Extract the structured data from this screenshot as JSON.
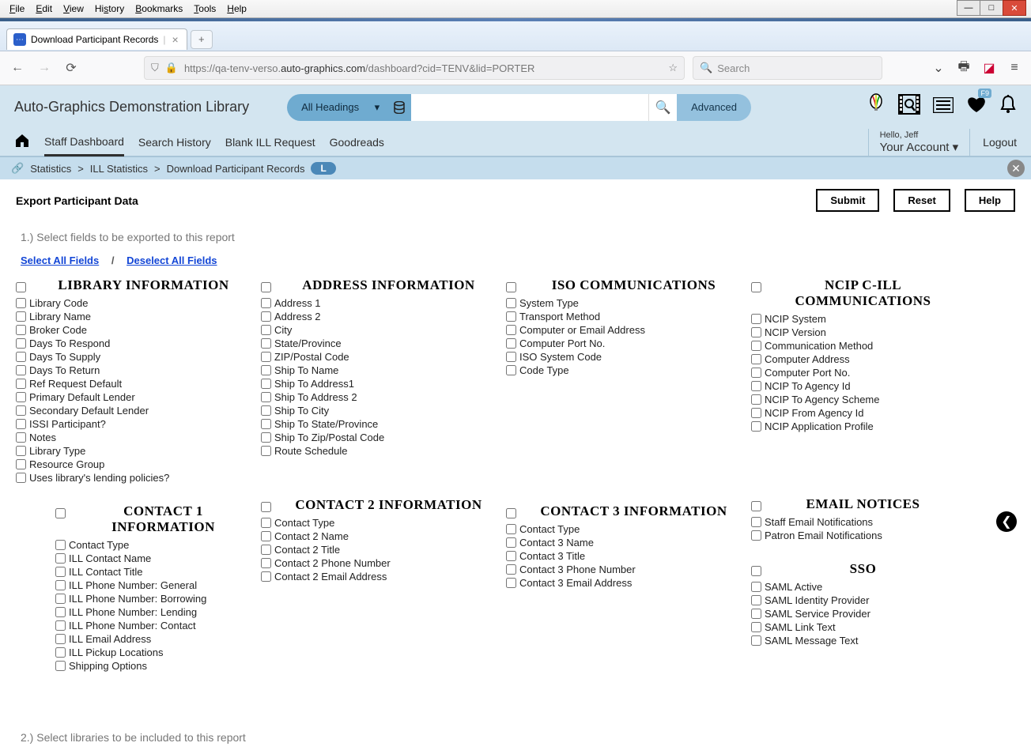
{
  "browser": {
    "menubar": [
      "File",
      "Edit",
      "View",
      "History",
      "Bookmarks",
      "Tools",
      "Help"
    ],
    "tab_title": "Download Participant Records",
    "url_display_prefix": "https://qa-tenv-verso.",
    "url_display_dark": "auto-graphics.com",
    "url_display_suffix": "/dashboard?cid=TENV&lid=PORTER",
    "search_placeholder": "Search"
  },
  "header": {
    "library_title": "Auto-Graphics Demonstration Library",
    "search_scope": "All Headings",
    "advanced_label": "Advanced",
    "badge": "F9"
  },
  "nav": {
    "items": [
      "Staff Dashboard",
      "Search History",
      "Blank ILL Request",
      "Goodreads"
    ],
    "hello": "Hello, Jeff",
    "account": "Your Account",
    "logout": "Logout"
  },
  "breadcrumb": {
    "items": [
      "Statistics",
      "ILL Statistics",
      "Download Participant Records"
    ],
    "pill": "L"
  },
  "page": {
    "title": "Export Participant Data",
    "submit": "Submit",
    "reset": "Reset",
    "help": "Help",
    "step1": "1.) Select fields to be exported to this report",
    "step2": "2.) Select libraries to be included to this report",
    "select_all": "Select All Fields",
    "deselect_all": "Deselect All Fields",
    "separator": "/"
  },
  "sections": {
    "library_info": {
      "title": "LIBRARY INFORMATION",
      "fields": [
        "Library Code",
        "Library Name",
        "Broker Code",
        "Days To Respond",
        "Days To Supply",
        "Days To Return",
        "Ref Request Default",
        "Primary Default Lender",
        "Secondary Default Lender",
        "ISSI Participant?",
        "Notes",
        "Library Type",
        "Resource Group",
        "Uses library's lending policies?"
      ]
    },
    "address_info": {
      "title": "ADDRESS INFORMATION",
      "fields": [
        "Address 1",
        "Address 2",
        "City",
        "State/Province",
        "ZIP/Postal Code",
        "Ship To Name",
        "Ship To Address1",
        "Ship To Address 2",
        "Ship To City",
        "Ship To State/Province",
        "Ship To Zip/Postal Code",
        "Route Schedule"
      ]
    },
    "iso": {
      "title": "ISO COMMUNICATIONS",
      "fields": [
        "System Type",
        "Transport Method",
        "Computer or Email Address",
        "Computer Port No.",
        "ISO System Code",
        "Code Type"
      ]
    },
    "ncip": {
      "title": "NCIP C-ILL COMMUNICATIONS",
      "fields": [
        "NCIP System",
        "NCIP Version",
        "Communication Method",
        "Computer Address",
        "Computer Port No.",
        "NCIP To Agency Id",
        "NCIP To Agency Scheme",
        "NCIP From Agency Id",
        "NCIP Application Profile"
      ]
    },
    "contact1": {
      "title": "CONTACT 1 INFORMATION",
      "fields": [
        "Contact Type",
        "ILL Contact Name",
        "ILL Contact Title",
        "ILL Phone Number: General",
        "ILL Phone Number: Borrowing",
        "ILL Phone Number: Lending",
        "ILL Phone Number: Contact",
        "ILL Email Address",
        "ILL Pickup Locations",
        "Shipping Options"
      ]
    },
    "contact2": {
      "title": "CONTACT 2 INFORMATION",
      "fields": [
        "Contact Type",
        "Contact 2 Name",
        "Contact 2 Title",
        "Contact 2 Phone Number",
        "Contact 2 Email Address"
      ]
    },
    "contact3": {
      "title": "CONTACT 3 INFORMATION",
      "fields": [
        "Contact Type",
        "Contact 3 Name",
        "Contact 3 Title",
        "Contact 3 Phone Number",
        "Contact 3 Email Address"
      ]
    },
    "email_notices": {
      "title": "EMAIL NOTICES",
      "fields": [
        "Staff Email Notifications",
        "Patron Email Notifications"
      ]
    },
    "sso": {
      "title": "SSO",
      "fields": [
        "SAML Active",
        "SAML Identity Provider",
        "SAML Service Provider",
        "SAML Link Text",
        "SAML Message Text"
      ]
    }
  }
}
